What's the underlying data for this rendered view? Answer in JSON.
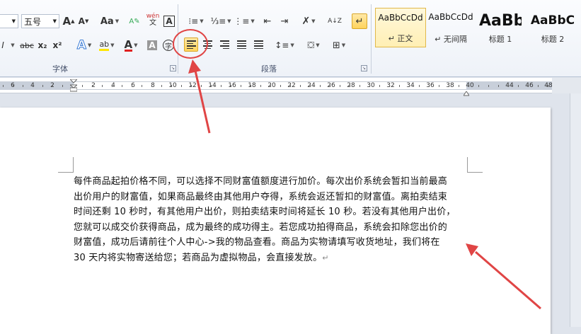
{
  "ribbon": {
    "font_size_value": "五号",
    "font_group_label": "字体",
    "paragraph_group_label": "段落",
    "grow_font": "A",
    "shrink_font": "A",
    "change_case": "Aa",
    "phonetic": "wén",
    "char_border": "A",
    "strikethrough": "abc",
    "subscript": "x₂",
    "superscript": "x²",
    "text_effect": "A",
    "font_color": "A",
    "char_shading": "A",
    "enclose_char": "字",
    "sort": "A↓Z",
    "styles": [
      {
        "sample": "AaBbCcDd",
        "name": "↵ 正文",
        "selected": true
      },
      {
        "sample": "AaBbCcDd",
        "name": "↵ 无间隔",
        "selected": false
      },
      {
        "sample": "AaBb",
        "name": "标题 1",
        "selected": false
      },
      {
        "sample": "AaBbC",
        "name": "标题 2",
        "selected": false
      }
    ]
  },
  "ruler": {
    "labels": [
      "6",
      "4",
      "2",
      "2",
      "4",
      "6",
      "8",
      "10",
      "12",
      "14",
      "16",
      "18",
      "20",
      "22",
      "24",
      "26",
      "28",
      "30",
      "32",
      "34",
      "36",
      "38",
      "40",
      "44",
      "46",
      "48"
    ]
  },
  "document": {
    "lines": [
      "每件商品起拍价格不同，可以选择不同财富值额度进行加价。每次出价系统会暂扣当前最高",
      "出价用户的财富值，如果商品最终由其他用户夺得，系统会返还暂扣的财富值。离拍卖结束",
      "时间还剩 10 秒时，有其他用户出价，则拍卖结束时间将延长 10 秒。若没有其他用户出价，",
      "您就可以成交价获得商品，成为最终的成功得主。若您成功拍得商品，系统会扣除您出价的",
      "财富值，成功后请前往个人中心->我的物品查看。商品为实物请填写收货地址，我们将在",
      "30 天内将实物寄送给您；若商品为虚拟物品，会直接发放。"
    ],
    "paragraph_mark": "↵"
  },
  "colors": {
    "accent": "#e04545",
    "active_button": "#ffd35c",
    "ribbon_bg": "#f3f6fb",
    "workspace_bg": "#dfe4ec"
  }
}
